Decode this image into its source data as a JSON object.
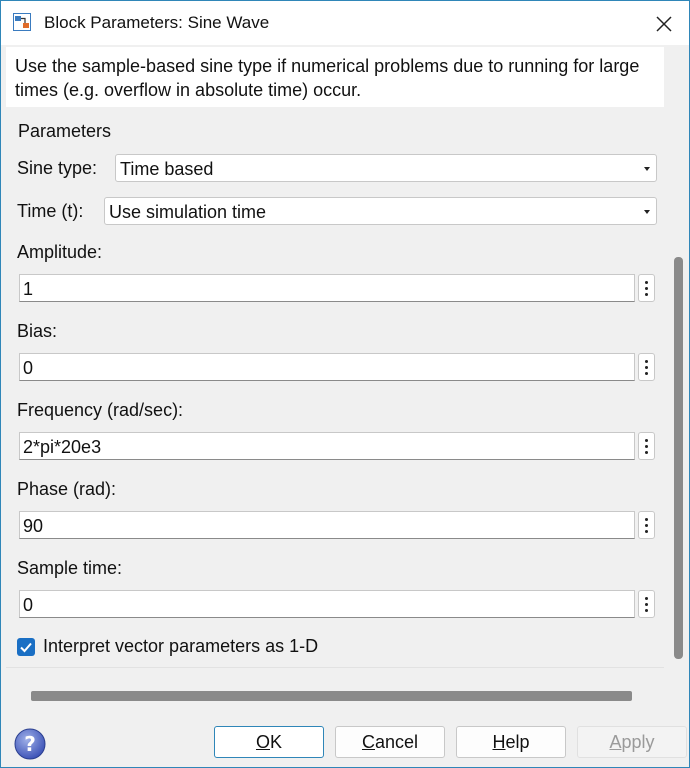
{
  "window": {
    "title": "Block Parameters: Sine Wave",
    "icon": "simulink-block-icon",
    "close_icon": "close-icon"
  },
  "description": "Use the sample-based sine type if numerical problems due to running for large times (e.g. overflow in absolute time) occur.",
  "parameters": {
    "legend": "Parameters",
    "sine_type": {
      "label": "Sine type:",
      "value": "Time based"
    },
    "time": {
      "label": "Time (t):",
      "value": "Use simulation time"
    },
    "fields": [
      {
        "label": "Amplitude:",
        "value": "1"
      },
      {
        "label": "Bias:",
        "value": "0"
      },
      {
        "label": "Frequency (rad/sec):",
        "value": "2*pi*20e3"
      },
      {
        "label": "Phase (rad):",
        "value": "90"
      },
      {
        "label": "Sample time:",
        "value": "0"
      }
    ],
    "interpret_vector": {
      "label": "Interpret vector parameters as 1-D",
      "checked": true
    }
  },
  "buttons": {
    "ok": {
      "mnemonic": "O",
      "rest": "K"
    },
    "cancel": {
      "mnemonic": "C",
      "rest": "ancel"
    },
    "help": {
      "mnemonic": "H",
      "rest": "elp"
    },
    "apply": {
      "mnemonic": "A",
      "rest": "pply",
      "enabled": false
    }
  },
  "colors": {
    "accent": "#1a6fc4",
    "window_border": "#2f86b8",
    "background": "#f0f0f0"
  }
}
